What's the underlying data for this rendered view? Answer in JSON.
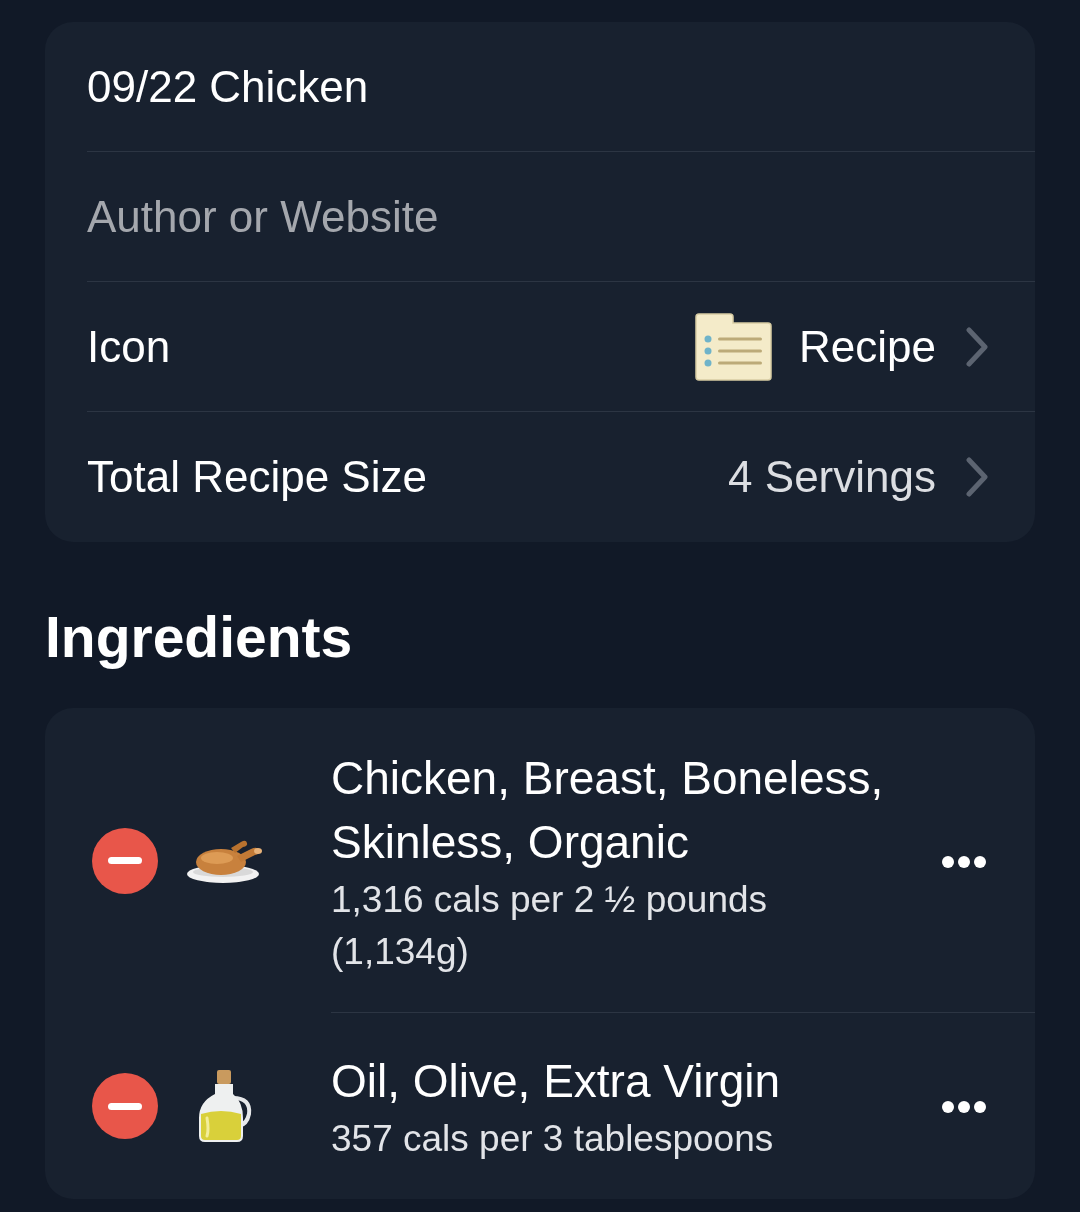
{
  "recipe_form": {
    "name_field": {
      "value": "09/22 Chicken"
    },
    "author_field": {
      "placeholder": "Author or Website"
    },
    "rows": [
      {
        "kind": "icon",
        "label": "Icon",
        "value": "Recipe"
      },
      {
        "kind": "size",
        "label": "Total Recipe Size",
        "value": "4 Servings"
      }
    ]
  },
  "ingredients": {
    "heading": "Ingredients",
    "items": [
      {
        "kind": "chicken",
        "name": "Chicken, Breast, Boneless, Skinless, Organic",
        "detail": "1,316 cals per 2 ½ pounds (1,134g)"
      },
      {
        "kind": "oil",
        "name": "Oil, Olive, Extra Virgin",
        "detail": "357 cals per 3 tablespoons"
      }
    ]
  }
}
